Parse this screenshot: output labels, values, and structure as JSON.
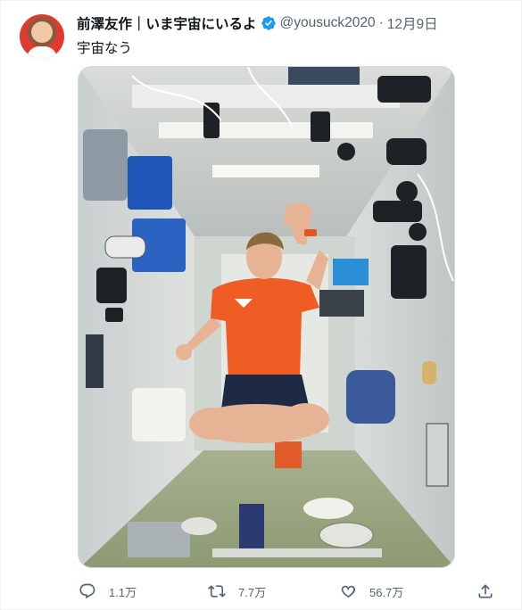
{
  "tweet": {
    "author_name": "前澤友作｜いま宇宙にいるよ",
    "handle": "@yousuck2020",
    "separator": "·",
    "date": "12月9日",
    "text": "宇宙なう"
  },
  "actions": {
    "reply_count": "1.1万",
    "retweet_count": "7.7万",
    "like_count": "56.7万"
  },
  "icons": {
    "verified": "verified-badge-icon",
    "reply": "reply-icon",
    "retweet": "retweet-icon",
    "like": "heart-icon",
    "share": "share-icon"
  },
  "colors": {
    "verified_blue": "#1d9bf0",
    "secondary_text": "#536471",
    "primary_text": "#0f1419"
  }
}
